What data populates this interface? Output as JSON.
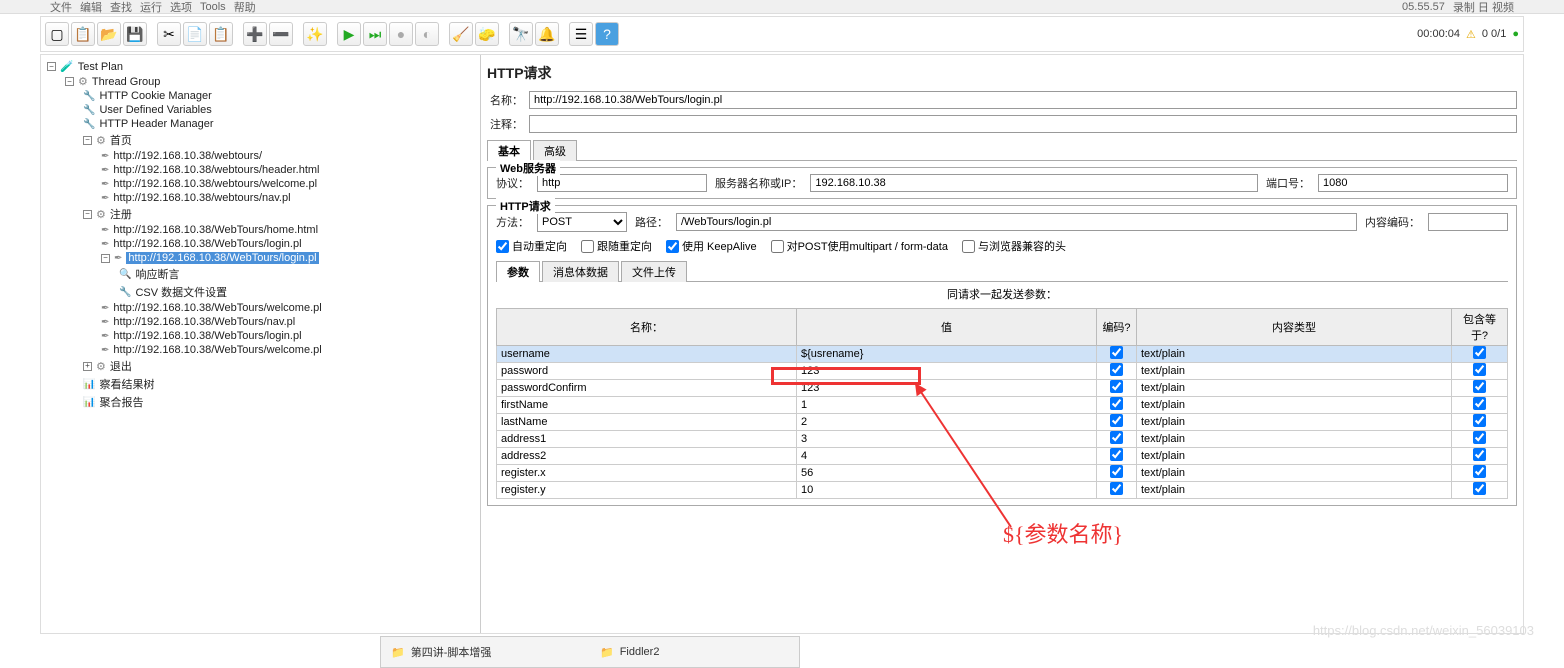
{
  "menubar": {
    "items": [
      "文件",
      "编辑",
      "查找",
      "运行",
      "选项",
      "Tools",
      "帮助"
    ],
    "clock": "05.55.57",
    "title_part": "录制 日 视频"
  },
  "toolbar_status": {
    "time": "00:00:04",
    "warn_icon": "⚠",
    "counts": "0  0/1"
  },
  "tree": {
    "root": "Test Plan",
    "thread_group": "Thread Group",
    "cookie": "HTTP Cookie Manager",
    "udv": "User Defined Variables",
    "header": "HTTP Header Manager",
    "home_folder": "首页",
    "home_items": [
      "http://192.168.10.38/webtours/",
      "http://192.168.10.38/webtours/header.html",
      "http://192.168.10.38/webtours/welcome.pl",
      "http://192.168.10.38/webtours/nav.pl"
    ],
    "reg_folder": "注册",
    "reg_items": [
      "http://192.168.10.38/WebTours/home.html",
      "http://192.168.10.38/WebTours/login.pl"
    ],
    "selected": "http://192.168.10.38/WebTours/login.pl",
    "assert": "响应断言",
    "csv": "CSV 数据文件设置",
    "reg_after": [
      "http://192.168.10.38/WebTours/welcome.pl",
      "http://192.168.10.38/WebTours/nav.pl",
      "http://192.168.10.38/WebTours/login.pl",
      "http://192.168.10.38/WebTours/welcome.pl"
    ],
    "exit_folder": "退出",
    "view_tree": "察看结果树",
    "agg": "聚合报告"
  },
  "panel": {
    "title": "HTTP请求",
    "name_label": "名称：",
    "name_value": "http://192.168.10.38/WebTours/login.pl",
    "comment_label": "注释：",
    "comment_value": "",
    "tabs": {
      "basic": "基本",
      "advanced": "高级"
    },
    "webserver": {
      "legend": "Web服务器",
      "protocol_label": "协议：",
      "protocol": "http",
      "server_label": "服务器名称或IP：",
      "server": "192.168.10.38",
      "port_label": "端口号：",
      "port": "1080"
    },
    "httpreq": {
      "legend": "HTTP请求",
      "method_label": "方法：",
      "method": "POST",
      "path_label": "路径：",
      "path": "/WebTours/login.pl",
      "encoding_label": "内容编码：",
      "encoding": ""
    },
    "checks": {
      "c1": "自动重定向",
      "c2": "跟随重定向",
      "c3": "使用 KeepAlive",
      "c4": "对POST使用multipart / form-data",
      "c5": "与浏览器兼容的头"
    },
    "subtabs": {
      "params": "参数",
      "body": "消息体数据",
      "files": "文件上传"
    },
    "param_header": "同请求一起发送参数：",
    "cols": {
      "name": "名称：",
      "value": "值",
      "encode": "编码?",
      "ctype": "内容类型",
      "include": "包含等于?"
    },
    "rows": [
      {
        "n": "username",
        "v": "${usrename}",
        "e": true,
        "c": "text/plain",
        "i": true
      },
      {
        "n": "password",
        "v": "123",
        "e": true,
        "c": "text/plain",
        "i": true
      },
      {
        "n": "passwordConfirm",
        "v": "123",
        "e": true,
        "c": "text/plain",
        "i": true
      },
      {
        "n": "firstName",
        "v": "1",
        "e": true,
        "c": "text/plain",
        "i": true
      },
      {
        "n": "lastName",
        "v": "2",
        "e": true,
        "c": "text/plain",
        "i": true
      },
      {
        "n": "address1",
        "v": "3",
        "e": true,
        "c": "text/plain",
        "i": true
      },
      {
        "n": "address2",
        "v": "4",
        "e": true,
        "c": "text/plain",
        "i": true
      },
      {
        "n": "register.x",
        "v": "56",
        "e": true,
        "c": "text/plain",
        "i": true
      },
      {
        "n": "register.y",
        "v": "10",
        "e": true,
        "c": "text/plain",
        "i": true
      }
    ]
  },
  "annotation": "${参数名称}",
  "taskbar": {
    "t1": "第四讲-脚本增强",
    "t2": "Fiddler2"
  },
  "watermark": "https://blog.csdn.net/weixin_56039103"
}
